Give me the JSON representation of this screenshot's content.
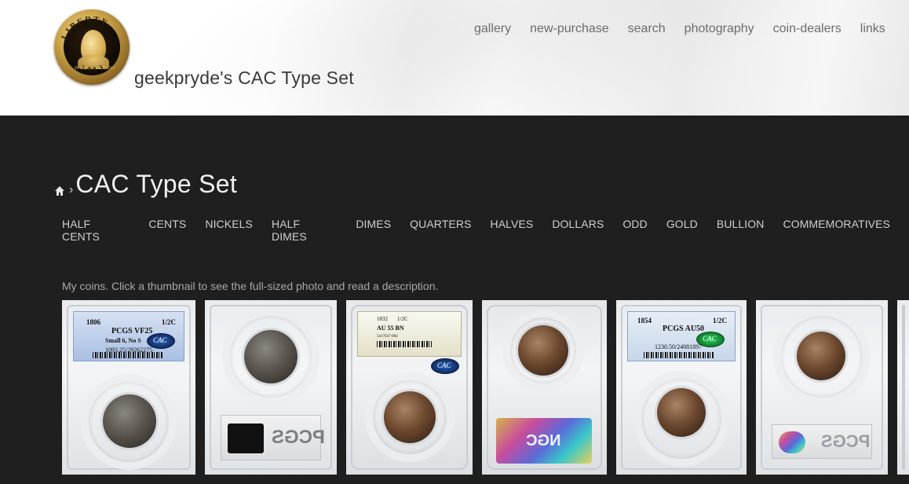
{
  "header": {
    "site_title": "geekpryde's CAC Type Set",
    "logo": {
      "icon": "kennedy-half-dollar-logo",
      "legend_top": "LIBERTY",
      "legend_left": "IN GOD",
      "legend_right": "WE TRUST",
      "date": "1983"
    },
    "nav": [
      "gallery",
      "new-purchase",
      "search",
      "photography",
      "coin-dealers",
      "links"
    ]
  },
  "breadcrumb": {
    "home_icon": "home-icon",
    "separator": "›"
  },
  "page_title": "CAC Type Set",
  "categories": [
    "HALF CENTS",
    "CENTS",
    "NICKELS",
    "HALF DIMES",
    "DIMES",
    "QUARTERS",
    "HALVES",
    "DOLLARS",
    "ODD",
    "GOLD",
    "BULLION",
    "COMMEMORATIVES"
  ],
  "description": "My coins. Click a thumbnail to see the full-sized photo and read a description.",
  "thumbnails": [
    {
      "year": "1806",
      "denom": "1/2C",
      "grade": "PCGS VF25",
      "variety": "Small 6, No S",
      "cert": "1093.25/29262275",
      "cac": "CAC"
    },
    {
      "back_label": "PCGS"
    },
    {
      "year": "1832",
      "denom": "1/2C",
      "grade": "AU 55 BN",
      "cert": "3417637-004",
      "cac": "CAC"
    },
    {
      "back_label": "NGC"
    },
    {
      "year": "1854",
      "denom": "1/2C",
      "grade": "PCGS AU50",
      "cert": "1230.50/24081897",
      "cac": "CAC"
    },
    {
      "back_label": "PCGS"
    }
  ],
  "colors": {
    "page_bg": "#1f1f1f",
    "title": "#f0f0f0",
    "category_text": "#cfcfcf",
    "nav_text": "#6c6c6c",
    "cac_green": "#1ea64a"
  }
}
